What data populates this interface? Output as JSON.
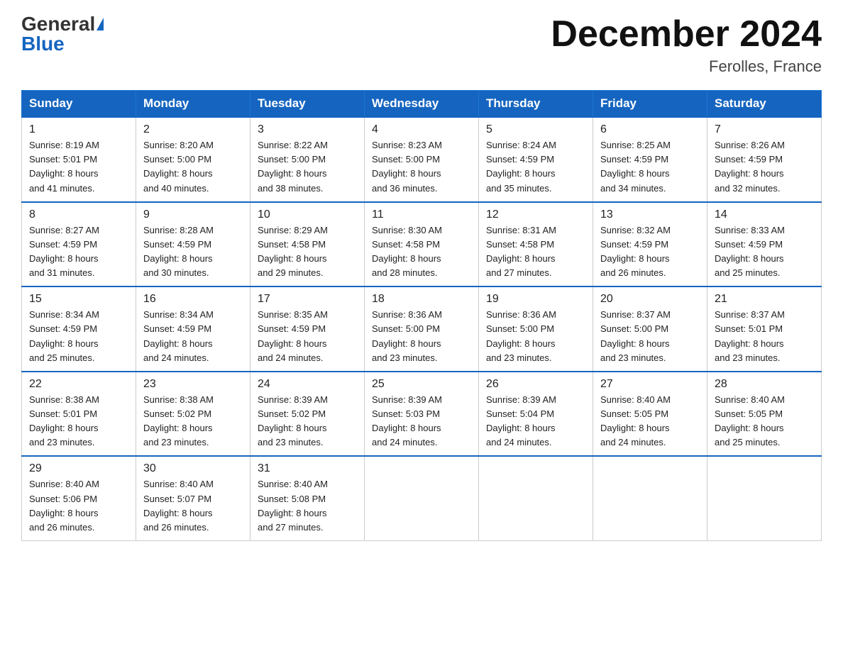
{
  "header": {
    "logo_general": "General",
    "logo_blue": "Blue",
    "month_title": "December 2024",
    "location": "Ferolles, France"
  },
  "days_of_week": [
    "Sunday",
    "Monday",
    "Tuesday",
    "Wednesday",
    "Thursday",
    "Friday",
    "Saturday"
  ],
  "weeks": [
    [
      {
        "day": "1",
        "sunrise": "8:19 AM",
        "sunset": "5:01 PM",
        "daylight": "8 hours and 41 minutes."
      },
      {
        "day": "2",
        "sunrise": "8:20 AM",
        "sunset": "5:00 PM",
        "daylight": "8 hours and 40 minutes."
      },
      {
        "day": "3",
        "sunrise": "8:22 AM",
        "sunset": "5:00 PM",
        "daylight": "8 hours and 38 minutes."
      },
      {
        "day": "4",
        "sunrise": "8:23 AM",
        "sunset": "5:00 PM",
        "daylight": "8 hours and 36 minutes."
      },
      {
        "day": "5",
        "sunrise": "8:24 AM",
        "sunset": "4:59 PM",
        "daylight": "8 hours and 35 minutes."
      },
      {
        "day": "6",
        "sunrise": "8:25 AM",
        "sunset": "4:59 PM",
        "daylight": "8 hours and 34 minutes."
      },
      {
        "day": "7",
        "sunrise": "8:26 AM",
        "sunset": "4:59 PM",
        "daylight": "8 hours and 32 minutes."
      }
    ],
    [
      {
        "day": "8",
        "sunrise": "8:27 AM",
        "sunset": "4:59 PM",
        "daylight": "8 hours and 31 minutes."
      },
      {
        "day": "9",
        "sunrise": "8:28 AM",
        "sunset": "4:59 PM",
        "daylight": "8 hours and 30 minutes."
      },
      {
        "day": "10",
        "sunrise": "8:29 AM",
        "sunset": "4:58 PM",
        "daylight": "8 hours and 29 minutes."
      },
      {
        "day": "11",
        "sunrise": "8:30 AM",
        "sunset": "4:58 PM",
        "daylight": "8 hours and 28 minutes."
      },
      {
        "day": "12",
        "sunrise": "8:31 AM",
        "sunset": "4:58 PM",
        "daylight": "8 hours and 27 minutes."
      },
      {
        "day": "13",
        "sunrise": "8:32 AM",
        "sunset": "4:59 PM",
        "daylight": "8 hours and 26 minutes."
      },
      {
        "day": "14",
        "sunrise": "8:33 AM",
        "sunset": "4:59 PM",
        "daylight": "8 hours and 25 minutes."
      }
    ],
    [
      {
        "day": "15",
        "sunrise": "8:34 AM",
        "sunset": "4:59 PM",
        "daylight": "8 hours and 25 minutes."
      },
      {
        "day": "16",
        "sunrise": "8:34 AM",
        "sunset": "4:59 PM",
        "daylight": "8 hours and 24 minutes."
      },
      {
        "day": "17",
        "sunrise": "8:35 AM",
        "sunset": "4:59 PM",
        "daylight": "8 hours and 24 minutes."
      },
      {
        "day": "18",
        "sunrise": "8:36 AM",
        "sunset": "5:00 PM",
        "daylight": "8 hours and 23 minutes."
      },
      {
        "day": "19",
        "sunrise": "8:36 AM",
        "sunset": "5:00 PM",
        "daylight": "8 hours and 23 minutes."
      },
      {
        "day": "20",
        "sunrise": "8:37 AM",
        "sunset": "5:00 PM",
        "daylight": "8 hours and 23 minutes."
      },
      {
        "day": "21",
        "sunrise": "8:37 AM",
        "sunset": "5:01 PM",
        "daylight": "8 hours and 23 minutes."
      }
    ],
    [
      {
        "day": "22",
        "sunrise": "8:38 AM",
        "sunset": "5:01 PM",
        "daylight": "8 hours and 23 minutes."
      },
      {
        "day": "23",
        "sunrise": "8:38 AM",
        "sunset": "5:02 PM",
        "daylight": "8 hours and 23 minutes."
      },
      {
        "day": "24",
        "sunrise": "8:39 AM",
        "sunset": "5:02 PM",
        "daylight": "8 hours and 23 minutes."
      },
      {
        "day": "25",
        "sunrise": "8:39 AM",
        "sunset": "5:03 PM",
        "daylight": "8 hours and 24 minutes."
      },
      {
        "day": "26",
        "sunrise": "8:39 AM",
        "sunset": "5:04 PM",
        "daylight": "8 hours and 24 minutes."
      },
      {
        "day": "27",
        "sunrise": "8:40 AM",
        "sunset": "5:05 PM",
        "daylight": "8 hours and 24 minutes."
      },
      {
        "day": "28",
        "sunrise": "8:40 AM",
        "sunset": "5:05 PM",
        "daylight": "8 hours and 25 minutes."
      }
    ],
    [
      {
        "day": "29",
        "sunrise": "8:40 AM",
        "sunset": "5:06 PM",
        "daylight": "8 hours and 26 minutes."
      },
      {
        "day": "30",
        "sunrise": "8:40 AM",
        "sunset": "5:07 PM",
        "daylight": "8 hours and 26 minutes."
      },
      {
        "day": "31",
        "sunrise": "8:40 AM",
        "sunset": "5:08 PM",
        "daylight": "8 hours and 27 minutes."
      },
      null,
      null,
      null,
      null
    ]
  ],
  "labels": {
    "sunrise": "Sunrise:",
    "sunset": "Sunset:",
    "daylight": "Daylight:"
  }
}
